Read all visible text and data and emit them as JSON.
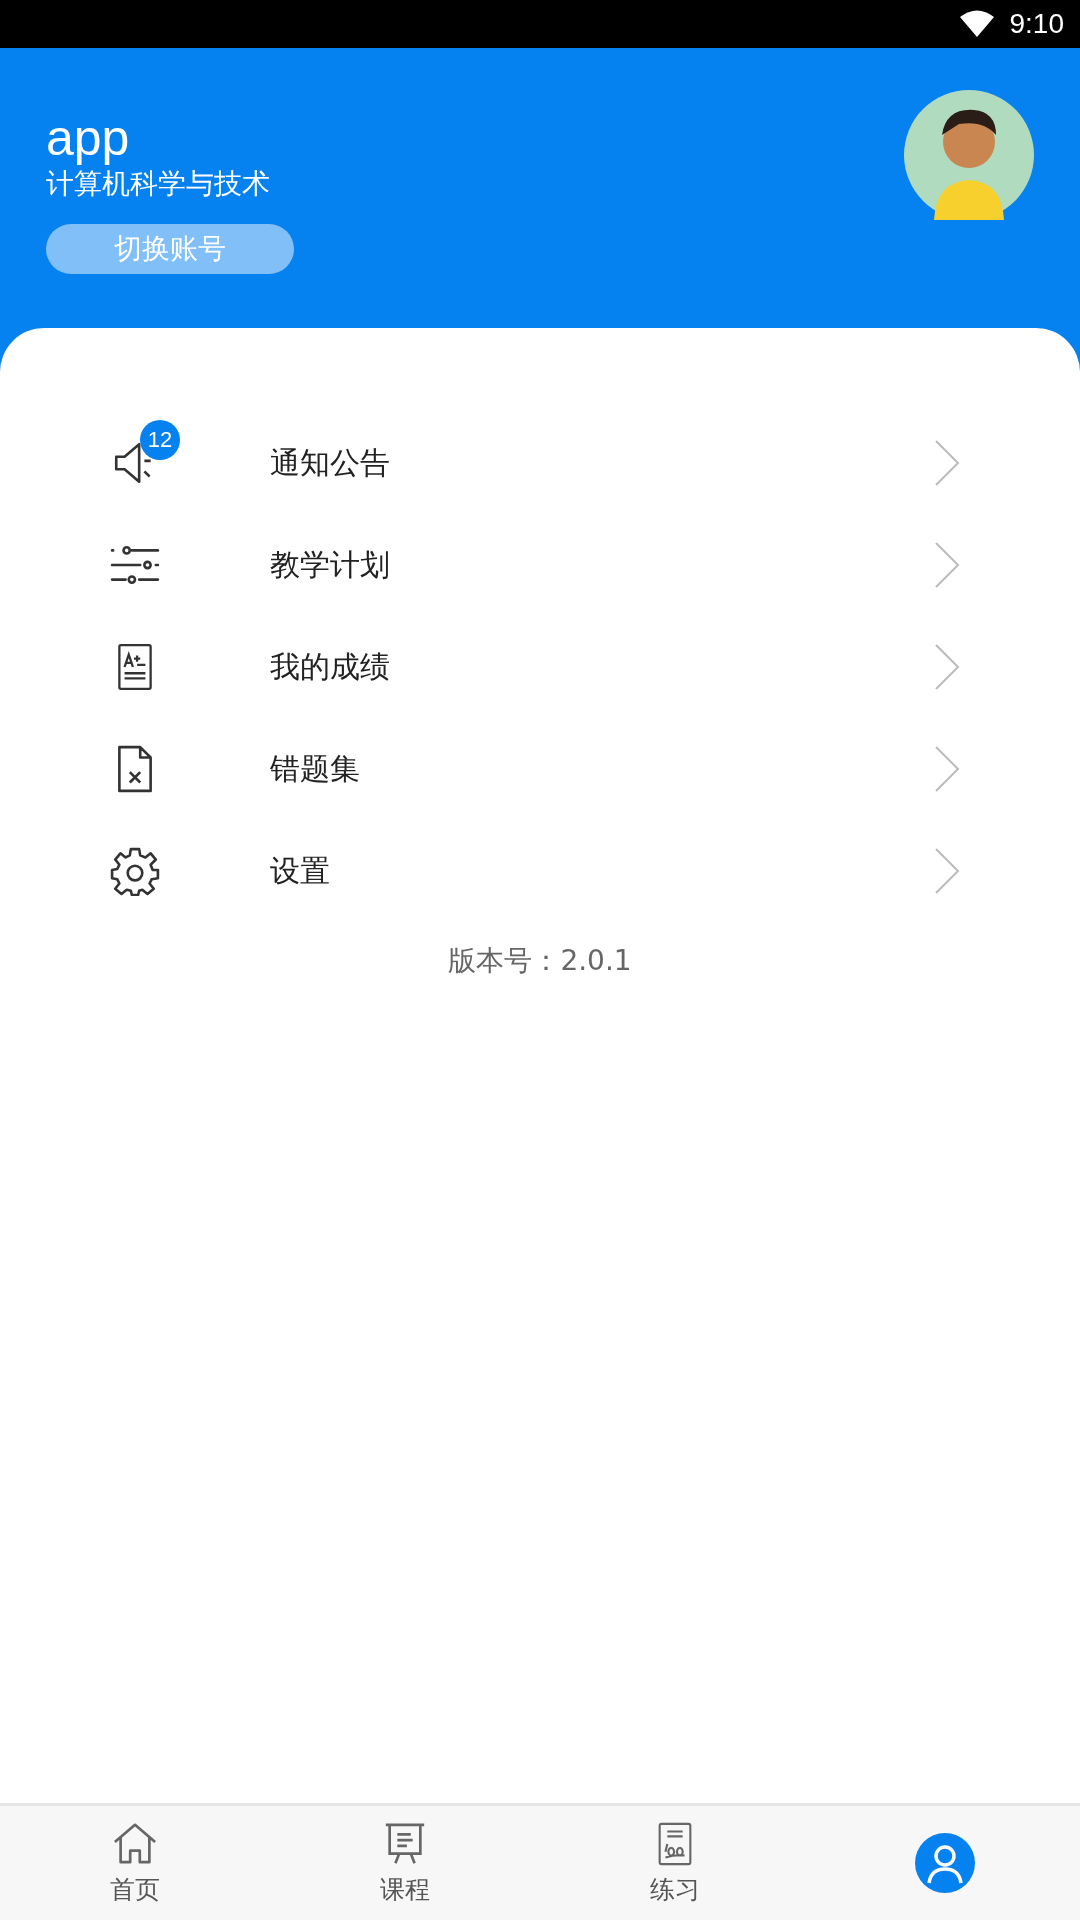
{
  "status_bar": {
    "time": "9:10"
  },
  "profile": {
    "name": "app",
    "major": "计算机科学与技术",
    "switch_button": "切换账号"
  },
  "menu": [
    {
      "kind": "notice",
      "label": "通知公告",
      "badge": "12"
    },
    {
      "kind": "plan",
      "label": "教学计划"
    },
    {
      "kind": "grades",
      "label": "我的成绩"
    },
    {
      "kind": "mistakes",
      "label": "错题集"
    },
    {
      "kind": "settings",
      "label": "设置"
    }
  ],
  "version": "版本号：2.0.1",
  "tabs": [
    {
      "kind": "home",
      "label": "首页",
      "selected": false
    },
    {
      "kind": "course",
      "label": "课程",
      "selected": false
    },
    {
      "kind": "practice",
      "label": "练习",
      "selected": false
    },
    {
      "kind": "me",
      "selected": true
    }
  ]
}
